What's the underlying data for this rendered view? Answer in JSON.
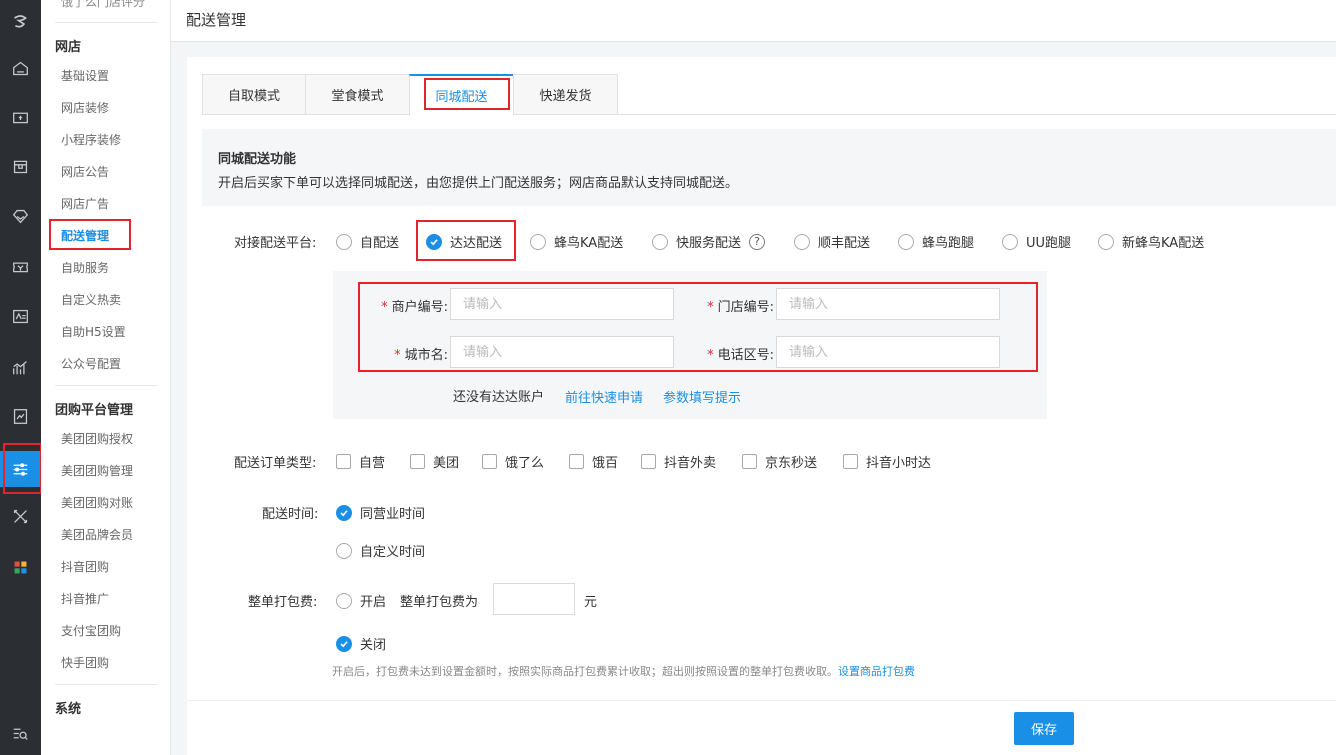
{
  "nav_rail": {
    "icons": [
      "logo-icon",
      "home-icon",
      "shop-icon",
      "store-icon",
      "diamond-icon",
      "coupon-icon",
      "card-icon",
      "chart-icon",
      "report-icon",
      "settings-sliders-icon",
      "tools-icon",
      "apps-icon",
      "menu-search-icon"
    ]
  },
  "menu": {
    "top_cut": "饿了么门店评分",
    "group_shop": "网店",
    "shop_items": [
      "基础设置",
      "网店装修",
      "小程序装修",
      "网店公告",
      "网店广告",
      "配送管理",
      "自助服务",
      "自定义热卖",
      "自助H5设置",
      "公众号配置"
    ],
    "group_groupbuy": "团购平台管理",
    "groupbuy_items": [
      "美团团购授权",
      "美团团购管理",
      "美团团购对账",
      "美团品牌会员",
      "抖音团购",
      "抖音推广",
      "支付宝团购",
      "快手团购"
    ],
    "group_system": "系统"
  },
  "header": {
    "title": "配送管理"
  },
  "tabs": [
    "自取模式",
    "堂食模式",
    "同城配送",
    "快递发货"
  ],
  "info": {
    "title": "同城配送功能",
    "desc": "开启后买家下单可以选择同城配送，由您提供上门配送服务；网店商品默认支持同城配送。"
  },
  "platform": {
    "label": "对接配送平台:",
    "options": [
      "自配送",
      "达达配送",
      "蜂鸟KA配送",
      "快服务配送",
      "顺丰配送",
      "蜂鸟跑腿",
      "UU跑腿",
      "新蜂鸟KA配送"
    ],
    "selected": "达达配送",
    "help_glyph": "?"
  },
  "dada_form": {
    "required_mark": "*",
    "merchant_label": "商户编号:",
    "store_label": "门店编号:",
    "city_label": "城市名:",
    "area_code_label": "电话区号:",
    "placeholder": "请输入",
    "no_account_text": "还没有达达账户",
    "apply_link": "前往快速申请",
    "tips_link": "参数填写提示"
  },
  "order_types": {
    "label": "配送订单类型:",
    "options": [
      "自营",
      "美团",
      "饿了么",
      "饿百",
      "抖音外卖",
      "京东秒送",
      "抖音小时达"
    ]
  },
  "delivery_time": {
    "label": "配送时间:",
    "options": [
      "同营业时间",
      "自定义时间"
    ],
    "selected": "同营业时间"
  },
  "packing_fee": {
    "label": "整单打包费:",
    "on_label": "开启",
    "fee_label": "整单打包费为",
    "unit": "元",
    "off_label": "关闭",
    "selected": "关闭",
    "note": "开启后，打包费未达到设置金额时，按照实际商品打包费累计收取；超出则按照设置的整单打包费收取。",
    "note_link": "设置商品打包费"
  },
  "save_label": "保存",
  "colors": {
    "accent": "#1a8fe6",
    "highlight_box": "#e3242b",
    "rail_bg": "#2b2e33"
  }
}
